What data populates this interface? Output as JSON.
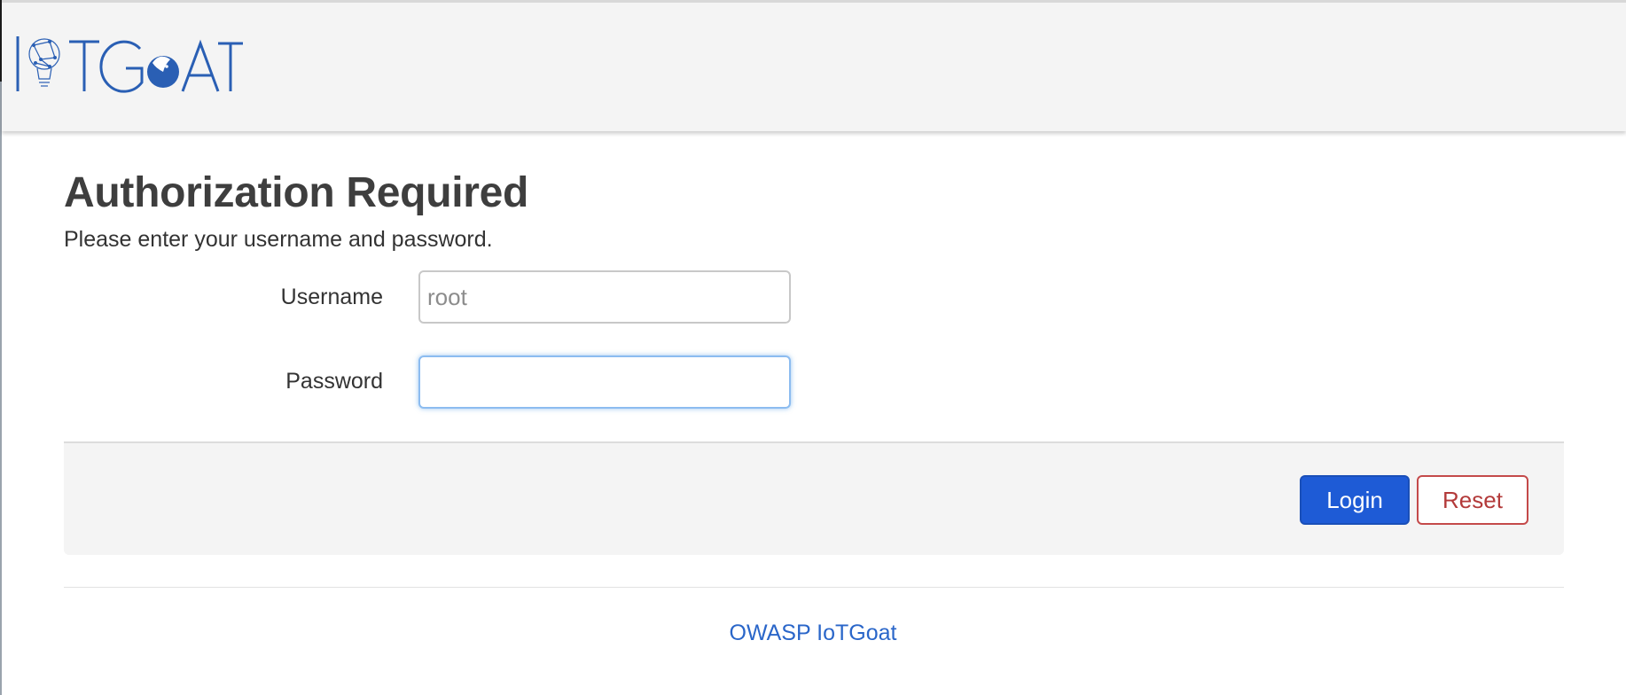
{
  "header": {
    "logo_text": "IoTGoat",
    "brand_color": "#2a5fb4"
  },
  "main": {
    "title": "Authorization Required",
    "description": "Please enter your username and password.",
    "username": {
      "label": "Username",
      "value": "",
      "placeholder": "root"
    },
    "password": {
      "label": "Password",
      "value": "",
      "placeholder": ""
    },
    "login_label": "Login",
    "reset_label": "Reset"
  },
  "footer": {
    "link_text": "OWASP IoTGoat"
  },
  "colors": {
    "primary_button": "#1e5bd6",
    "reset_text": "#b33a3a",
    "link": "#2a66c9"
  }
}
